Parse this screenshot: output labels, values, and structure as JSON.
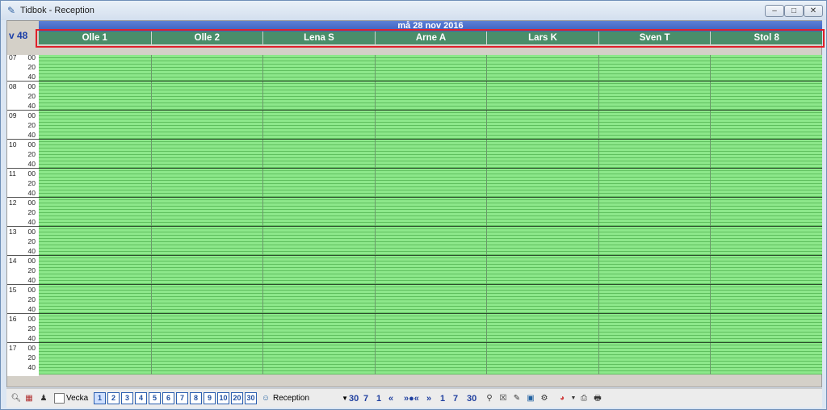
{
  "window": {
    "title": "Tidbok - Reception"
  },
  "calendar": {
    "date": "må 28 nov 2016",
    "week": "v 48",
    "columns": [
      "Olle 1",
      "Olle 2",
      "Lena S",
      "Arne A",
      "Lars K",
      "Sven T",
      "Stol 8"
    ],
    "hours": [
      "07",
      "08",
      "09",
      "10",
      "11",
      "12",
      "13",
      "14",
      "15",
      "16",
      "17"
    ],
    "minutes": [
      "00",
      "20",
      "40"
    ]
  },
  "colors": {
    "slot_bg": "#8de88b",
    "header_bg": "#4a8e6a",
    "date_bar": "#3b5fc0",
    "highlight": "#e0202a"
  },
  "toolbar": {
    "vecka_label": "Vecka",
    "day_buttons": [
      "1",
      "2",
      "3",
      "4",
      "5",
      "6",
      "7",
      "8",
      "9",
      "10",
      "20",
      "30"
    ],
    "selected_day_button": "1",
    "reception_select": "Reception",
    "nav": [
      "30",
      "7",
      "1",
      "«",
      "»●«",
      "»",
      "1",
      "7",
      "30"
    ]
  }
}
